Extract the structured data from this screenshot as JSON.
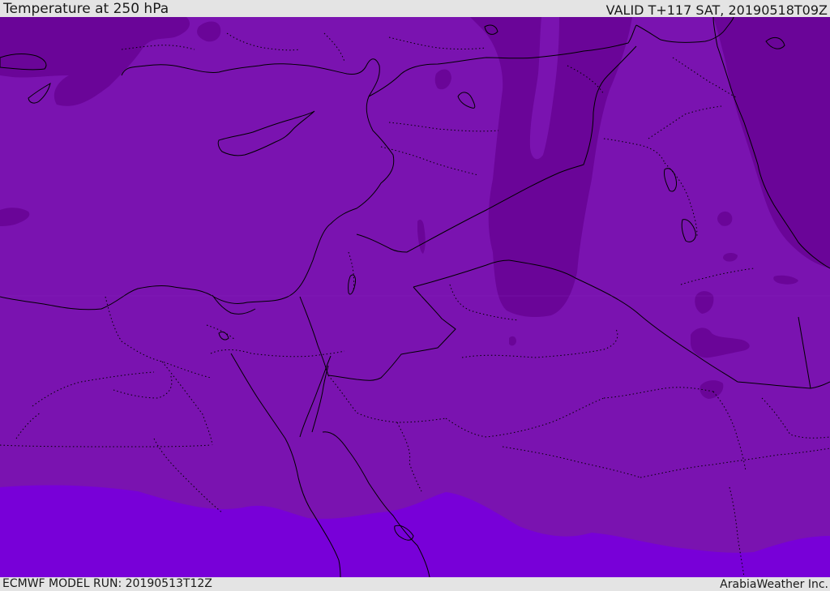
{
  "header": {
    "title": "Temperature at 250 hPa",
    "valid_time": "VALID T+117 SAT, 20190518T09Z"
  },
  "footer": {
    "model_run": "ECMWF MODEL RUN: 20190513T12Z",
    "credit": "ArabiaWeather Inc."
  },
  "colors": {
    "base": "#7a13b0",
    "cold": "#6a0598",
    "colder": "#5f0490",
    "warm": "#7800d8",
    "border": "#000000",
    "bar_bg": "#e4e4e4"
  }
}
